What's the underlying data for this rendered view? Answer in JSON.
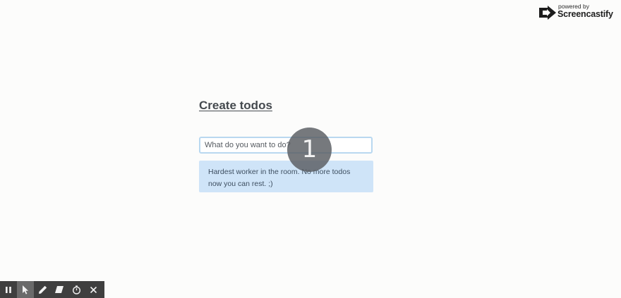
{
  "watermark": {
    "small_text": "powered by",
    "brand": "Screencastify"
  },
  "todo": {
    "title": "Create todos",
    "input_placeholder": "What do you want to do?",
    "input_value": "",
    "empty_message": "Hardest worker in the room. No more todos now you can rest. ;)"
  },
  "overlay": {
    "click_count": "1"
  },
  "recorder_toolbar": {
    "tools": [
      "pause-icon",
      "cursor-icon",
      "pen-icon",
      "eraser-icon",
      "timer-icon",
      "close-icon"
    ],
    "active_tool": "cursor-icon",
    "background": "#3f3f3f"
  },
  "colors": {
    "input_border": "#b9d8f0",
    "message_background": "#cfe4f8",
    "title": "#454a4f"
  }
}
